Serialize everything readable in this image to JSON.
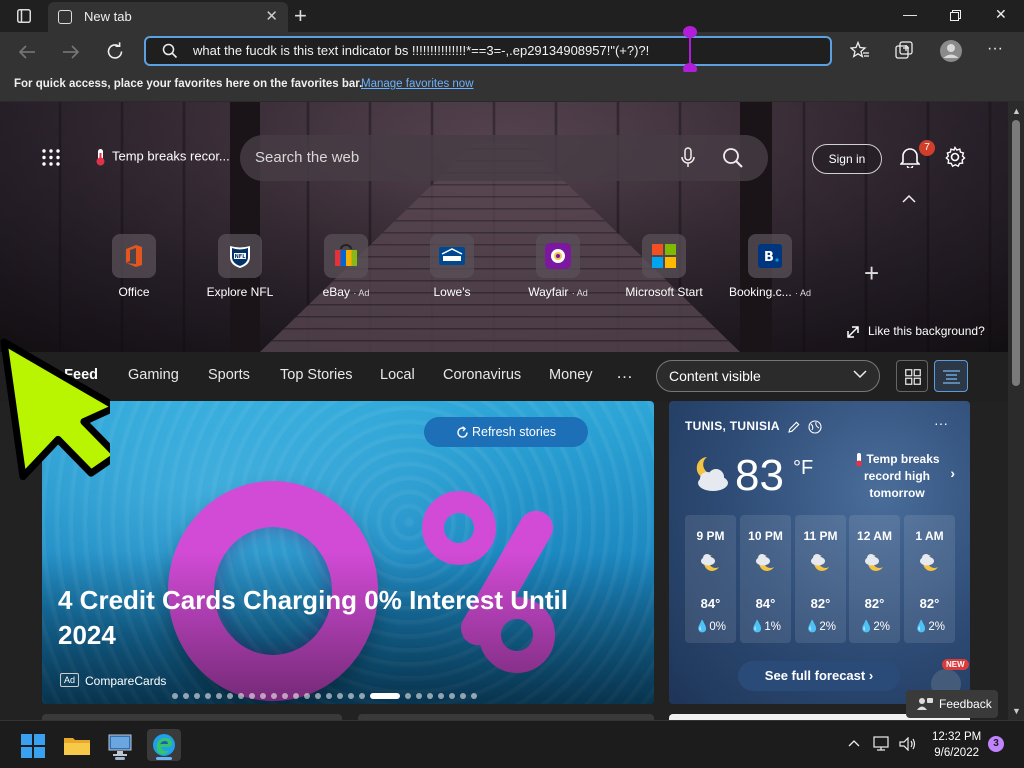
{
  "tab": {
    "title": "New tab"
  },
  "address_bar": {
    "value": "what the fucdk is this text indicator bs !!!!!!!!!!!!!!!*==3=-,.ep29134908957!\"(+?)?!"
  },
  "favorites_bar": {
    "message": "For quick access, place your favorites here on the favorites bar.",
    "link": "Manage favorites now"
  },
  "header": {
    "temp_chip": "Temp breaks recor...",
    "search_placeholder": "Search the web",
    "sign_in": "Sign in",
    "notification_count": "7"
  },
  "quick_links": [
    {
      "label": "Office",
      "ad": ""
    },
    {
      "label": "Explore NFL",
      "ad": ""
    },
    {
      "label": "eBay",
      "ad": "Ad"
    },
    {
      "label": "Lowe's",
      "ad": ""
    },
    {
      "label": "Wayfair",
      "ad": "Ad"
    },
    {
      "label": "Microsoft Start",
      "ad": ""
    },
    {
      "label": "Booking.c...",
      "ad": "Ad"
    }
  ],
  "background_link": "Like this background?",
  "feed_nav": {
    "items": [
      "My Feed",
      "Gaming",
      "Sports",
      "Top Stories",
      "Local",
      "Coronavirus",
      "Money"
    ],
    "more": "…",
    "content_select": "Content visible"
  },
  "hero_card": {
    "refresh": "Refresh stories",
    "headline": "4 Credit Cards Charging 0% Interest Until 2024",
    "ad_tag": "Ad",
    "source": "CompareCards",
    "dot_count": 26,
    "active_dot": 18
  },
  "weather": {
    "location": "TUNIS, TUNISIA",
    "temperature": "83",
    "unit": "°F",
    "alert": "Temp breaks record high tomorrow",
    "hours": [
      {
        "time": "9 PM",
        "temp": "84°",
        "rain": "0%"
      },
      {
        "time": "10 PM",
        "temp": "84°",
        "rain": "1%"
      },
      {
        "time": "11 PM",
        "temp": "82°",
        "rain": "2%"
      },
      {
        "time": "12 AM",
        "temp": "82°",
        "rain": "2%"
      },
      {
        "time": "1 AM",
        "temp": "82°",
        "rain": "2%"
      }
    ],
    "forecast_button": "See full forecast",
    "new_badge": "NEW"
  },
  "feedback": "Feedback",
  "taskbar": {
    "time": "12:32 PM",
    "date": "9/6/2022",
    "notifications": "3"
  },
  "colors": {
    "accent": "#5ba0e0",
    "selection_handle": "#b11ed8",
    "pointer": "#b9f400",
    "badge": "#d13f2a"
  }
}
